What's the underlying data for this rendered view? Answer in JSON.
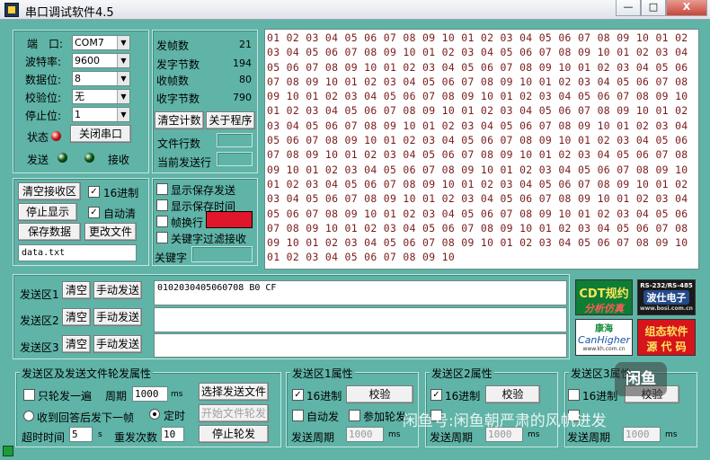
{
  "window": {
    "title": "串口调试软件4.5",
    "minimize_label": "—",
    "restore_label": "□",
    "close_label": "X"
  },
  "port": {
    "port_label": "端　口:",
    "port_value": "COM7",
    "baud_label": "波特率:",
    "baud_value": "9600",
    "databits_label": "数据位:",
    "databits_value": "8",
    "parity_label": "校验位:",
    "parity_value": "无",
    "stopbits_label": "停止位:",
    "stopbits_value": "1",
    "status_label": "状态",
    "close_port_button": "关闭串口",
    "send_label": "发送",
    "recv_label": "接收",
    "status_led_color": "#e31a1a",
    "send_led_color": "#0b5a12",
    "recv_led_color": "#0b5a12"
  },
  "stats": {
    "frames_sent_label": "发帧数",
    "frames_sent": "21",
    "bytes_sent_label": "发字节数",
    "bytes_sent": "194",
    "frames_recv_label": "收帧数",
    "frames_recv": "80",
    "bytes_recv_label": "收字节数",
    "bytes_recv": "790",
    "clear_count_button": "清空计数",
    "about_button": "关于程序",
    "file_lines_label": "文件行数",
    "current_line_label": "当前发送行"
  },
  "receive": {
    "clear_button": "清空接收区",
    "hex_label": "16进制",
    "hex_checked": true,
    "stop_display_button": "停止显示",
    "auto_clear_label": "自动清",
    "auto_clear_checked": true,
    "save_button": "保存数据",
    "change_file_button": "更改文件",
    "file_name": "data.txt",
    "hex_text": "01 02 03 04 05 06 07 08 09 10 01 02 03 04 05 06 07 08 09 10 01 02 03 04 05 06 07 08 09 10 01 02 03 04 05 06 07 08 09 10 01 02 03 04 05 06 07 08 09 10 01 02 03 04 05 06 07 08 09 10 01 02 03 04 05 06 07 08 09 10 01 02 03 04 05 06 07 08 09 10 01 02 03 04 05 06 07 08 09 10 01 02 03 04 05 06 07 08 09 10 01 02 03 04 05 06 07 08 09 10 01 02 03 04 05 06 07 08 09 10 01 02 03 04 05 06 07 08 09 10 01 02 03 04 05 06 07 08 09 10 01 02 03 04 05 06 07 08 09 10 01 02 03 04 05 06 07 08 09 10 01 02 03 04 05 06 07 08 09 10 01 02 03 04 05 06 07 08 09 10 01 02 03 04 05 06 07 08 09 10 01 02 03 04 05 06 07 08 09 10 01 02 03 04 05 06 07 08 09 10 01 02 03 04 05 06 07 08 09 10 01 02 03 04 05 06 07 08 09 10 01 02 03 04 05 06 07 08 09 10 01 02 03 04 05 06 07 08 09 10 01 02 03 04 05 06 07 08 09 10 01 02 03 04 05 06 07 08 09 10 01 02 03 04 05 06 07 08 09 10 01 02 03 04 05 06 07 08 09 10 01 02 03 04 05 06 07 08 09 10 01 02 03 04 05 06 07 08 09 10 01 02 03 04 05 06 07 08 09 10 01 02 03 04 05 06 07 08 09 10 01 02 03 04 05 06 07 08 09 10"
  },
  "display_opts": {
    "show_save_send": "显示保存发送",
    "show_save_time": "显示保存时间",
    "frame_newline": "帧换行",
    "keyword_filter": "关键字过滤接收",
    "keyword_label": "关键字"
  },
  "send_areas": [
    {
      "label": "发送区1",
      "clear": "清空",
      "manual": "手动发送",
      "value": "0102030405060708 B0 CF"
    },
    {
      "label": "发送区2",
      "clear": "清空",
      "manual": "手动发送",
      "value": ""
    },
    {
      "label": "发送区3",
      "clear": "清空",
      "manual": "手动发送",
      "value": ""
    }
  ],
  "logos": {
    "cdt_line1": "CDT规约",
    "cdt_line2": "分析仿真",
    "bosi_top": "RS-232/RS-485",
    "bosi_main": "波仕电子",
    "bosi_url": "www.bosi.com.cn",
    "kanghai_cn": "康海",
    "kanghai_en": "CanHigher",
    "kanghai_url": "www.kh.com.cn",
    "config_line1": "组态软件",
    "config_line2": "源 代 码"
  },
  "rotation": {
    "title": "发送区及发送文件轮发属性",
    "only_once": "只轮发一遍",
    "period_label": "周期",
    "period_value": "1000",
    "period_unit": "ms",
    "select_file_button": "选择发送文件",
    "recv_reply_label": "收到回答后发下一帧",
    "timed_label": "定时",
    "timed_selected": true,
    "start_file_button": "开始文件轮发",
    "timeout_label": "超时时间",
    "timeout_value": "5",
    "timeout_unit": "s",
    "resend_label": "重发次数",
    "resend_value": "10",
    "stop_button": "停止轮发"
  },
  "area_props": [
    {
      "title": "发送区1属性",
      "hex": "16进制",
      "hex_checked": true,
      "check_button": "校验",
      "auto_send": "自动发",
      "append": "参加轮发",
      "period": "发送周期",
      "period_value": "1000",
      "unit": "ms"
    },
    {
      "title": "发送区2属性",
      "hex": "16进制",
      "hex_checked": true,
      "check_button": "校验",
      "auto_send": "自动发",
      "append": "",
      "period": "发送周期",
      "period_value": "1000",
      "unit": "ms"
    },
    {
      "title": "发送区3属性",
      "hex": "16进制",
      "hex_checked": false,
      "check_button": "校验",
      "auto_send": "",
      "append": "",
      "period": "发送周期",
      "period_value": "1000",
      "unit": "ms"
    }
  ],
  "overlays": {
    "watermark": "闲鱼号:闲鱼朝严肃的风帆进发",
    "badge": "闲鱼"
  }
}
